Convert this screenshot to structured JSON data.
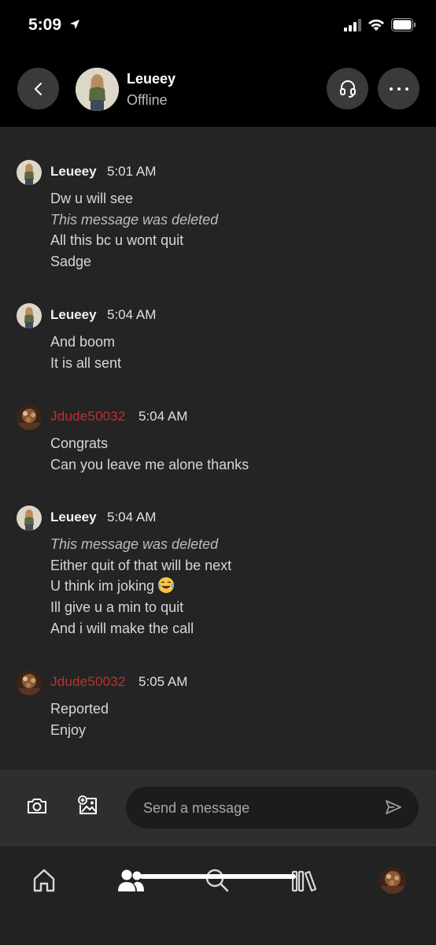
{
  "status_bar": {
    "time": "5:09"
  },
  "header": {
    "name": "Leueey",
    "status": "Offline"
  },
  "messages": [
    {
      "sender": "Leueey",
      "time": "5:01 AM",
      "lines": [
        {
          "text": "Dw u will see",
          "deleted": false
        },
        {
          "text": "This message was deleted",
          "deleted": true
        },
        {
          "text": "All this bc u wont quit",
          "deleted": false
        },
        {
          "text": "Sadge",
          "deleted": false
        }
      ]
    },
    {
      "sender": "Leueey",
      "time": "5:04 AM",
      "lines": [
        {
          "text": "And boom",
          "deleted": false
        },
        {
          "text": "It is all sent",
          "deleted": false
        }
      ]
    },
    {
      "sender": "Jdude50032",
      "time": "5:04 AM",
      "lines": [
        {
          "text": "Congrats",
          "deleted": false
        },
        {
          "text": "Can you leave me alone thanks",
          "deleted": false
        }
      ]
    },
    {
      "sender": "Leueey",
      "time": "5:04 AM",
      "lines": [
        {
          "text": "This message was deleted",
          "deleted": true
        },
        {
          "text": "Either quit of that will be next",
          "deleted": false
        },
        {
          "text": "U think im joking",
          "deleted": false,
          "emoji": "laughing-tears-emoji"
        },
        {
          "text": "Ill give u a min to quit",
          "deleted": false
        },
        {
          "text": "And i will make the call",
          "deleted": false
        }
      ]
    },
    {
      "sender": "Jdude50032",
      "time": "5:05 AM",
      "lines": [
        {
          "text": "Reported",
          "deleted": false
        },
        {
          "text": "Enjoy",
          "deleted": false
        }
      ]
    }
  ],
  "composer": {
    "placeholder": "Send a message"
  },
  "nav": {
    "items": [
      "home-icon",
      "friends-icon",
      "search-icon",
      "library-icon",
      "profile-avatar"
    ],
    "active": "friends-icon"
  },
  "colors": {
    "background": "#242424",
    "header": "#000000",
    "accent_red": "#c0302e"
  }
}
